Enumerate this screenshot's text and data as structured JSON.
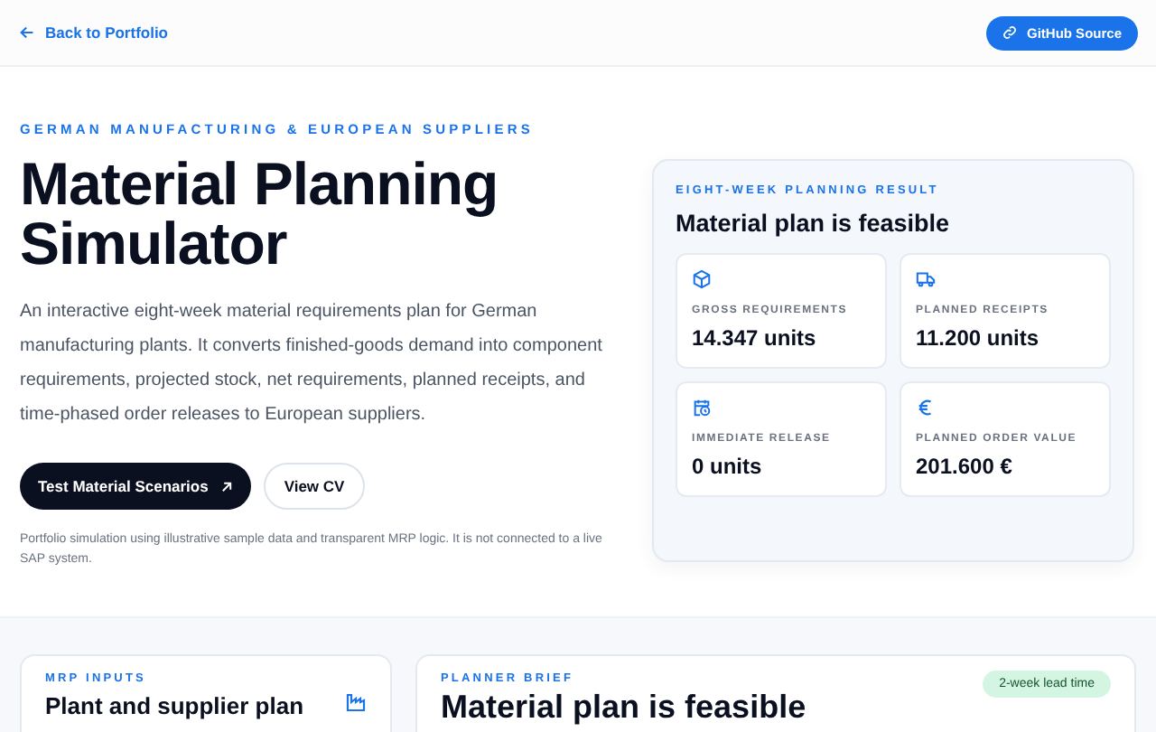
{
  "nav": {
    "back_link": "Back to Portfolio",
    "source_button": "GitHub Source"
  },
  "hero": {
    "eyebrow": "GERMAN MANUFACTURING & EUROPEAN SUPPLIERS",
    "title": "Material Planning Simulator",
    "description": "An interactive eight-week material requirements plan for German manufacturing plants. It converts finished-goods demand into component requirements, projected stock, net requirements, planned receipts, and time-phased order releases to European suppliers.",
    "buttons": [
      {
        "label": "Test Material Scenarios",
        "kind": "primary"
      },
      {
        "label": "View CV",
        "kind": "secondary"
      }
    ],
    "disclaimer": "Portfolio simulation using illustrative sample data and transparent MRP logic. It is not connected to a live SAP system."
  },
  "result": {
    "eyebrow": "EIGHT-WEEK PLANNING RESULT",
    "title": "Material plan is feasible",
    "stats": [
      {
        "kind": "box",
        "label": "GROSS REQUIREMENTS",
        "value": "14.347 units"
      },
      {
        "kind": "truck",
        "label": "PLANNED RECEIPTS",
        "value": "11.200 units"
      },
      {
        "kind": "calendar",
        "label": "IMMEDIATE RELEASE",
        "value": "0 units"
      },
      {
        "kind": "euro",
        "label": "PLANNED ORDER VALUE",
        "value": "201.600 €"
      }
    ]
  },
  "inputs_card": {
    "eyebrow": "MRP INPUTS",
    "title": "Plant and supplier plan"
  },
  "brief_card": {
    "eyebrow": "PLANNER BRIEF",
    "title": "Material plan is feasible",
    "badge": "2-week lead time"
  }
}
